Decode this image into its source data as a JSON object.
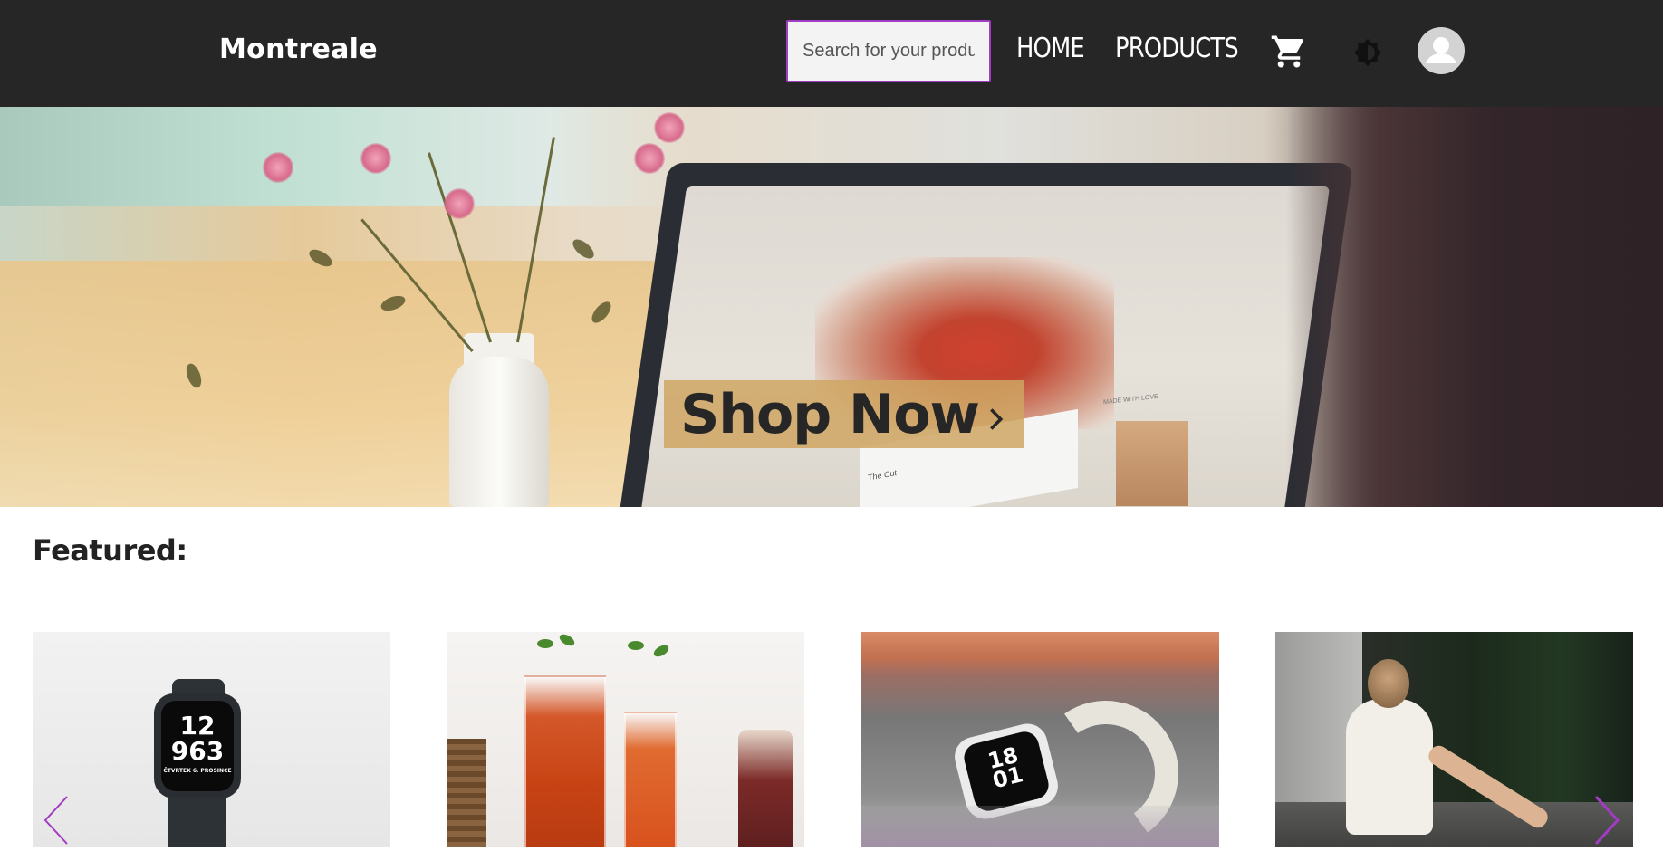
{
  "navbar": {
    "brand": "Montreale",
    "search": {
      "placeholder": "Search for your products",
      "value": ""
    },
    "links": [
      {
        "label": "HOME"
      },
      {
        "label": "PRODUCTS"
      }
    ],
    "icons": {
      "cart": "shopping-cart-icon",
      "theme": "brightness-icon",
      "avatar": "account-circle-icon"
    },
    "colors": {
      "background": "#262626",
      "search_border": "#a13cc3",
      "text": "#ffffff"
    }
  },
  "hero": {
    "cta_label": "Shop Now",
    "cta_icon": "chevron-right-icon",
    "cta_color": "#cfa663",
    "screen_texts": [
      "The Cut",
      "MADE WITH LOVE"
    ]
  },
  "featured": {
    "title": "Featured:",
    "products": [
      {
        "image": "smartwatch-black-sport-band",
        "watch_time": [
          "12",
          "963"
        ],
        "watch_date": "ČTVRTEK 6. PROSINCE"
      },
      {
        "image": "iced-tea-drinks"
      },
      {
        "image": "smartwatch-starlight-loop",
        "watch_time": [
          "18",
          "01"
        ]
      },
      {
        "image": "woman-white-dress-sitting"
      }
    ],
    "carousel": {
      "prev_icon": "chevron-left-icon",
      "next_icon": "chevron-right-icon",
      "arrow_color": "#a13cc3"
    }
  }
}
